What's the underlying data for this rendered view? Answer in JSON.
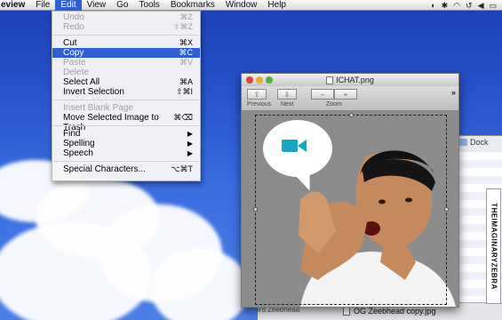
{
  "menubar": {
    "app": "eview",
    "items": [
      "File",
      "Edit",
      "View",
      "Go",
      "Tools",
      "Bookmarks",
      "Window",
      "Help"
    ]
  },
  "edit_menu": {
    "items": [
      {
        "label": "Undo",
        "shortcut": "⌘Z",
        "disabled": true
      },
      {
        "label": "Redo",
        "shortcut": "⇧⌘Z",
        "disabled": true
      },
      {
        "sep": true
      },
      {
        "label": "Cut",
        "shortcut": "⌘X",
        "disabled": false
      },
      {
        "label": "Copy",
        "shortcut": "⌘C",
        "disabled": false,
        "selected": true
      },
      {
        "label": "Paste",
        "shortcut": "⌘V",
        "disabled": true
      },
      {
        "label": "Delete",
        "shortcut": "",
        "disabled": true
      },
      {
        "label": "Select All",
        "shortcut": "⌘A",
        "disabled": false
      },
      {
        "label": "Invert Selection",
        "shortcut": "⇧⌘I",
        "disabled": false
      },
      {
        "sep": true
      },
      {
        "label": "Insert Blank Page",
        "shortcut": "",
        "disabled": true
      },
      {
        "label": "Move Selected Image to Trash",
        "shortcut": "⌘⌫",
        "disabled": false
      },
      {
        "sep": true
      },
      {
        "label": "Find",
        "shortcut": "",
        "submenu": true
      },
      {
        "label": "Spelling",
        "shortcut": "",
        "submenu": true
      },
      {
        "label": "Speech",
        "shortcut": "",
        "submenu": true
      },
      {
        "sep": true
      },
      {
        "label": "Special Characters...",
        "shortcut": "⌥⌘T",
        "disabled": false
      }
    ]
  },
  "preview": {
    "title": "ICHAT.png",
    "toolbar": {
      "previous": "Previous",
      "next": "Next",
      "zoom": "Zoom",
      "minus": "−",
      "plus": "+",
      "more": "»"
    }
  },
  "finder": {
    "tab": "Dock",
    "file": "OG Zeebhead copy.jpg",
    "ghost": "ird Zeebheaa"
  },
  "watermark": "THEIMAGINARYZEBRA",
  "colors": {
    "accent": "#2f5fd6",
    "cam": "#1aa5c6"
  }
}
